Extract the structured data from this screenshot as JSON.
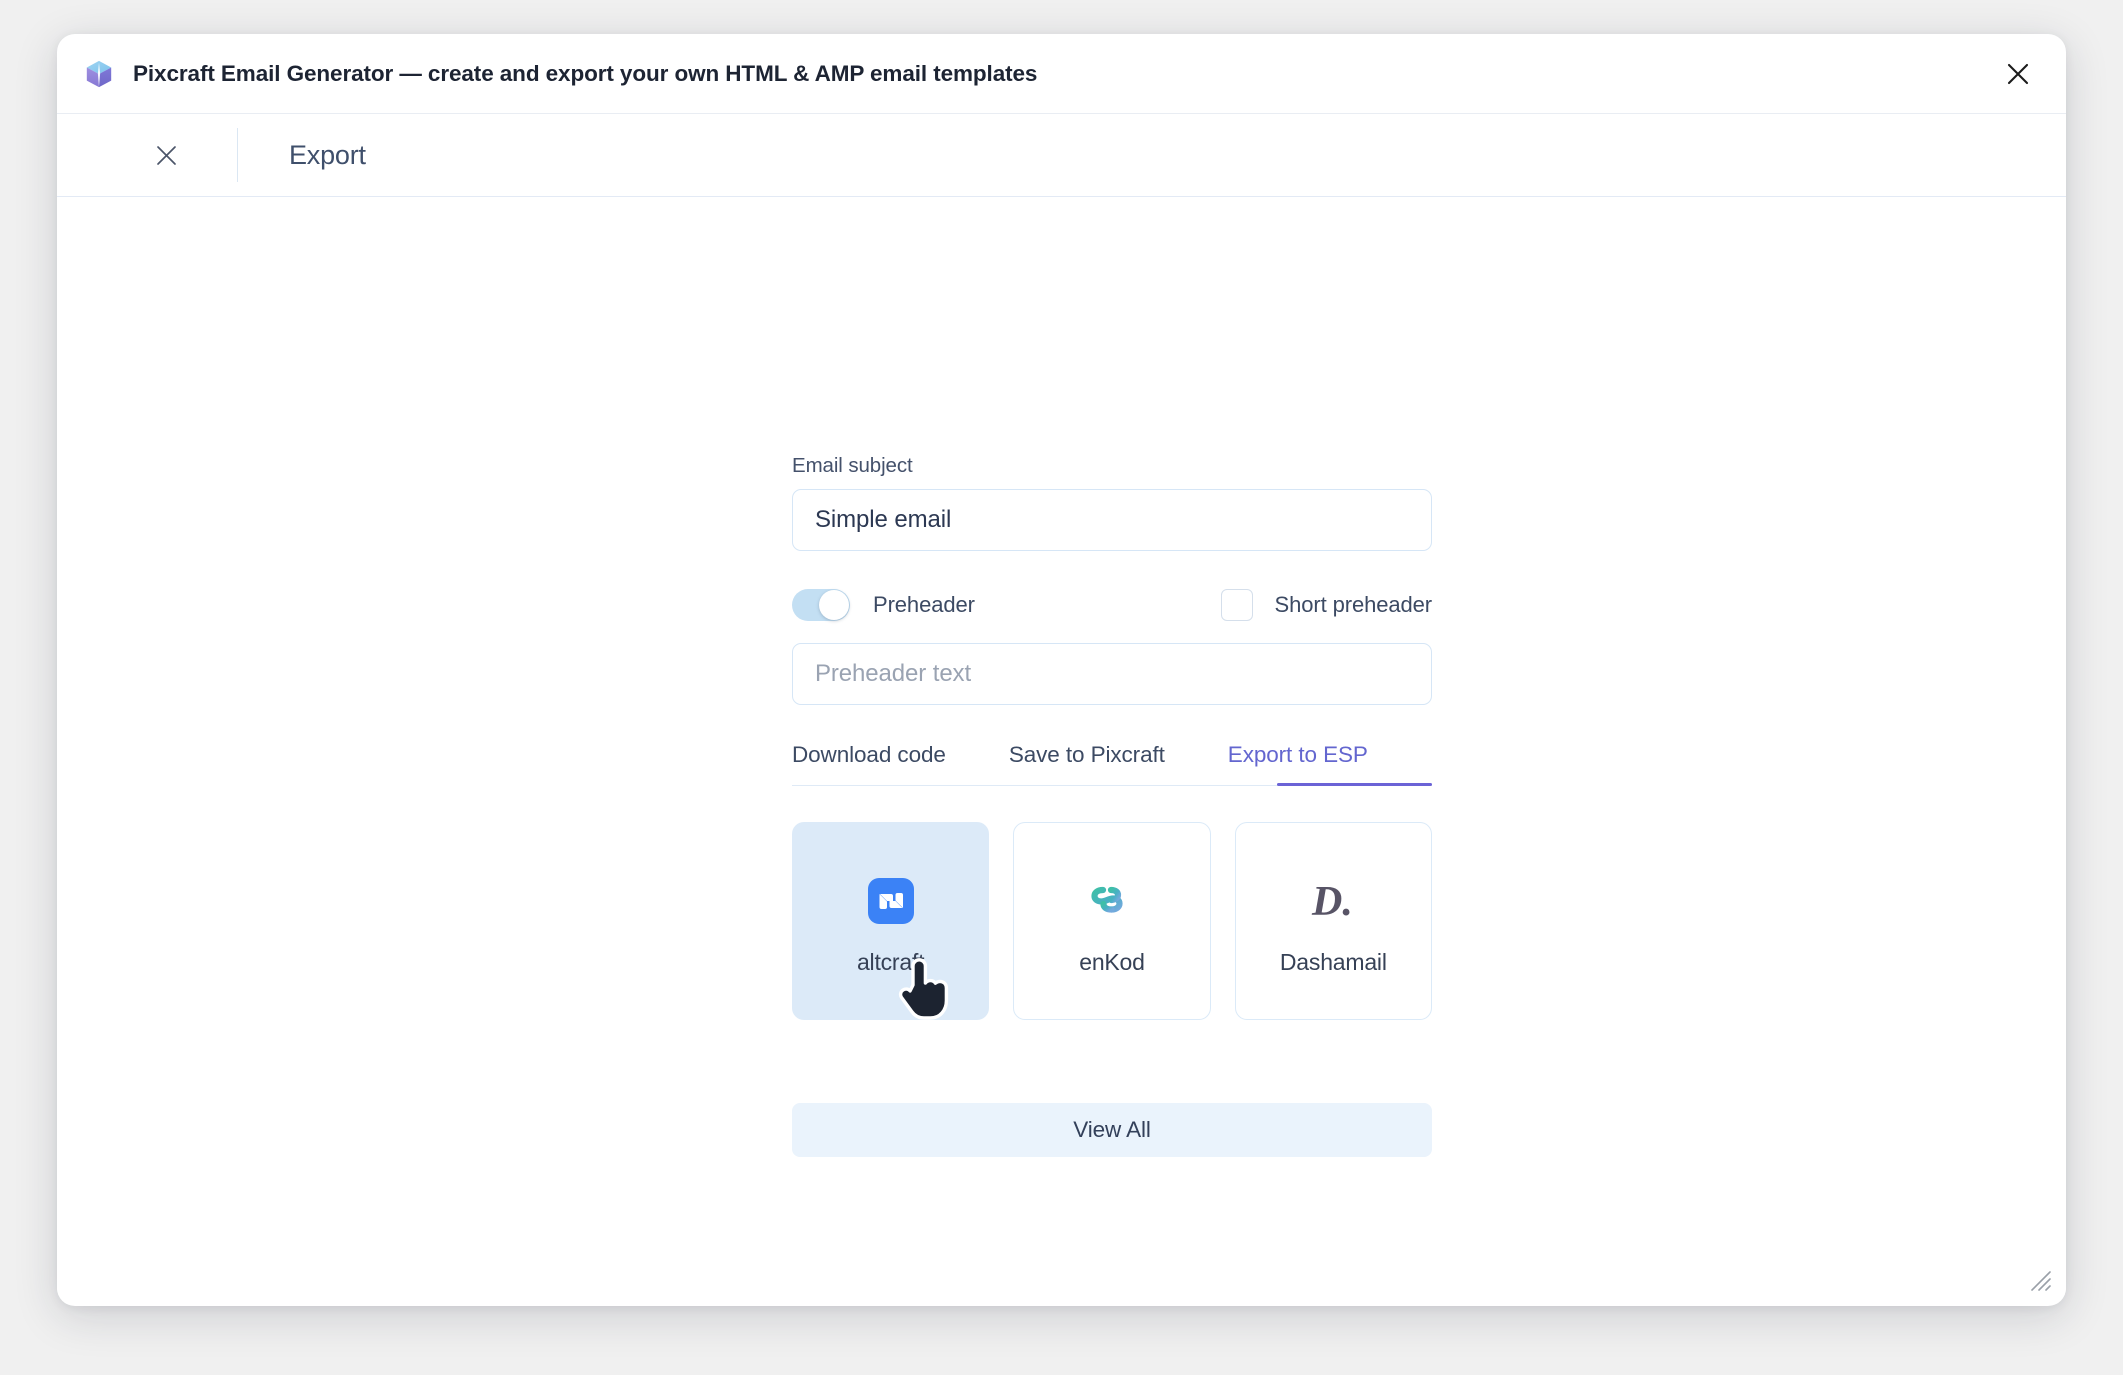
{
  "window": {
    "title": "Pixcraft Email Generator — create and export your own HTML & AMP email templates",
    "app_icon": "cube-icon",
    "close_icon": "close-icon",
    "resize_handle_icon": "resize-grip-icon"
  },
  "modal": {
    "close_icon": "close-icon",
    "title": "Export"
  },
  "form": {
    "subject": {
      "label": "Email subject",
      "value": "Simple email",
      "placeholder": "Email subject"
    },
    "preheader_toggle": {
      "label": "Preheader",
      "state": "on"
    },
    "short_preheader": {
      "label": "Short preheader",
      "state": "off"
    },
    "preheader_text": {
      "value": "",
      "placeholder": "Preheader text"
    }
  },
  "tabs": [
    {
      "label": "Download code",
      "active": false
    },
    {
      "label": "Save to Pixcraft",
      "active": false
    },
    {
      "label": "Export to ESP",
      "active": true
    }
  ],
  "esp_cards": [
    {
      "name": "altcraft",
      "logo": "altcraft-logo-icon",
      "selected": true
    },
    {
      "name": "enKod",
      "logo": "enkod-logo-icon",
      "selected": false
    },
    {
      "name": "Dashamail",
      "logo": "dashamail-logo-icon",
      "selected": false
    }
  ],
  "view_all": {
    "label": "View All"
  },
  "cursor": {
    "type": "pointing-hand"
  },
  "colors": {
    "accent": "#6b63d6",
    "selected_card_bg": "#dceaf8",
    "toggle_on": "#c3dff3",
    "view_all_bg": "#eaf3fc",
    "altcraft_blue": "#3b82f6",
    "enkod_teal": "#3fb3ab",
    "dashamail_gray": "#585466"
  }
}
